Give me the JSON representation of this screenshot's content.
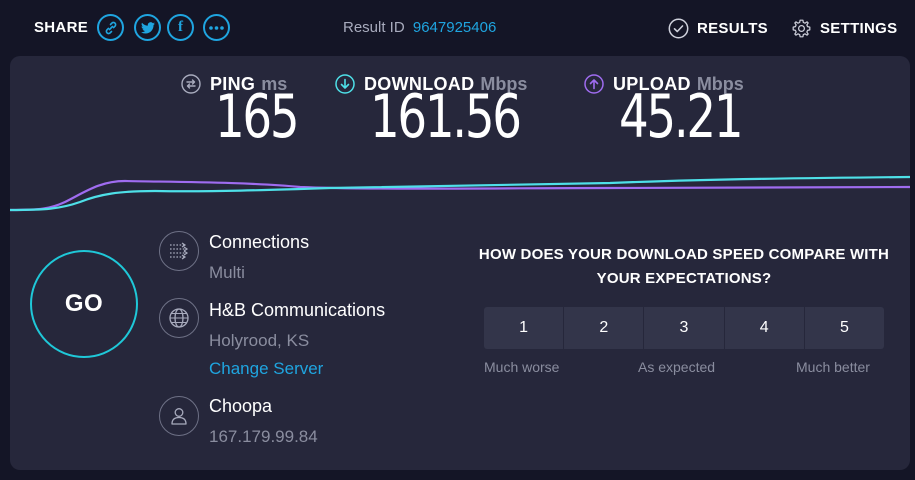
{
  "topbar": {
    "share_label": "SHARE",
    "share_buttons": [
      {
        "icon": "link-icon"
      },
      {
        "icon": "twitter-icon"
      },
      {
        "icon": "facebook-icon",
        "glyph": "f"
      },
      {
        "icon": "more-icon"
      }
    ],
    "result_label": "Result ID",
    "result_id": "9647925406",
    "results_label": "RESULTS",
    "settings_label": "SETTINGS"
  },
  "metrics": {
    "ping": {
      "name": "PING",
      "unit": "ms",
      "value": "165"
    },
    "download": {
      "name": "DOWNLOAD",
      "unit": "Mbps",
      "value": "161.56"
    },
    "upload": {
      "name": "UPLOAD",
      "unit": "Mbps",
      "value": "45.21"
    }
  },
  "go_label": "GO",
  "connections": {
    "title": "Connections",
    "value": "Multi"
  },
  "server": {
    "name": "H&B Communications",
    "location": "Holyrood, KS",
    "change_label": "Change Server"
  },
  "isp": {
    "name": "Choopa",
    "ip": "167.179.99.84"
  },
  "survey": {
    "question": "HOW DOES YOUR DOWNLOAD SPEED COMPARE WITH YOUR EXPECTATIONS?",
    "options": [
      "1",
      "2",
      "3",
      "4",
      "5"
    ],
    "low_label": "Much worse",
    "mid_label": "As expected",
    "high_label": "Much better"
  },
  "colors": {
    "accent": "#1fa5e0",
    "download_line": "#4ee0e8",
    "upload_line": "#9f6cf0",
    "background": "#141526",
    "panel": "#26273b"
  }
}
